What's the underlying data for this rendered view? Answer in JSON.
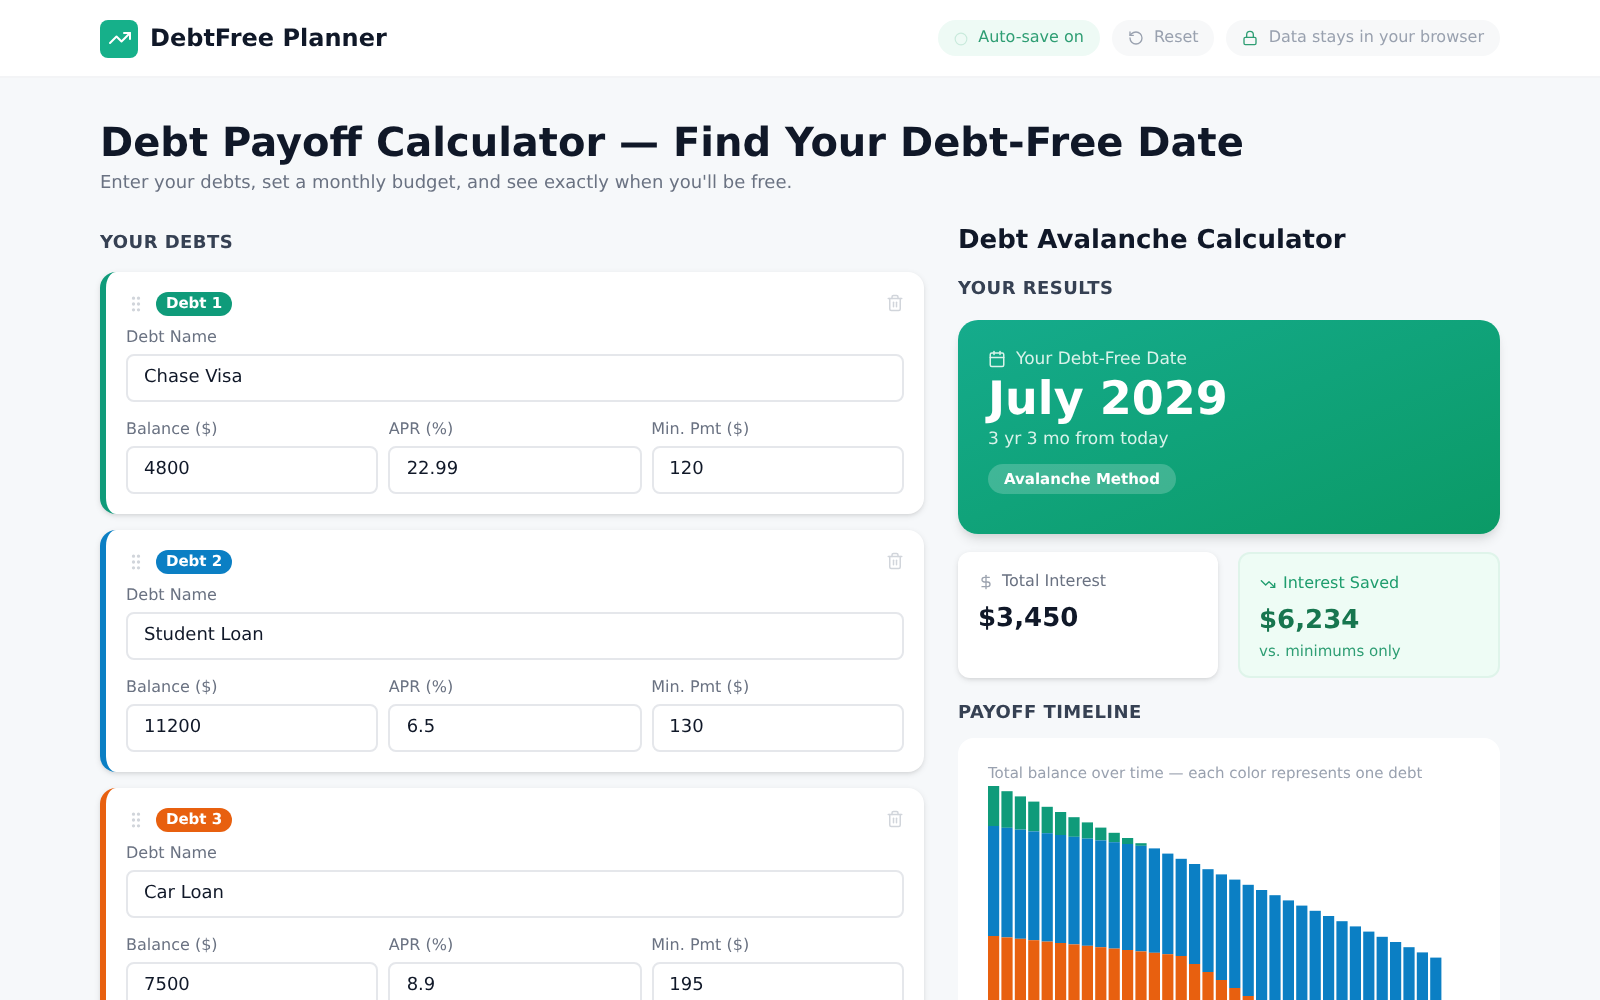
{
  "header": {
    "brand": "DebtFree Planner",
    "autosave": "Auto-save on",
    "reset": "Reset",
    "privacy": "Data stays in your browser"
  },
  "page": {
    "title": "Debt Payoff Calculator — Find Your Debt-Free Date",
    "subtitle": "Enter your debts, set a monthly budget, and see exactly when you'll be free."
  },
  "debts_section": {
    "heading": "YOUR DEBTS",
    "debts": [
      {
        "badge": "Debt 1",
        "color": "#0f9b7a",
        "name_label": "Debt Name",
        "name": "Chase Visa",
        "balance_label": "Balance ($)",
        "balance": "4800",
        "apr_label": "APR (%)",
        "apr": "22.99",
        "min_label": "Min. Pmt ($)",
        "min": "120"
      },
      {
        "badge": "Debt 2",
        "color": "#0b7fc4",
        "name_label": "Debt Name",
        "name": "Student Loan",
        "balance_label": "Balance ($)",
        "balance": "11200",
        "apr_label": "APR (%)",
        "apr": "6.5",
        "min_label": "Min. Pmt ($)",
        "min": "130"
      },
      {
        "badge": "Debt 3",
        "color": "#e8600f",
        "name_label": "Debt Name",
        "name": "Car Loan",
        "balance_label": "Balance ($)",
        "balance": "7500",
        "apr_label": "APR (%)",
        "apr": "8.9",
        "min_label": "Min. Pmt ($)",
        "min": "195"
      }
    ]
  },
  "results": {
    "title": "Debt Avalanche Calculator",
    "heading": "YOUR RESULTS",
    "date_label": "Your Debt-Free Date",
    "date": "July 2029",
    "from_today": "3 yr 3 mo from today",
    "method": "Avalanche Method",
    "total_interest_label": "Total Interest",
    "total_interest": "$3,450",
    "saved_label": "Interest Saved",
    "saved": "$6,234",
    "saved_note": "vs. minimums only"
  },
  "timeline": {
    "heading": "PAYOFF TIMELINE",
    "caption": "Total balance over time — each color represents one debt"
  }
}
